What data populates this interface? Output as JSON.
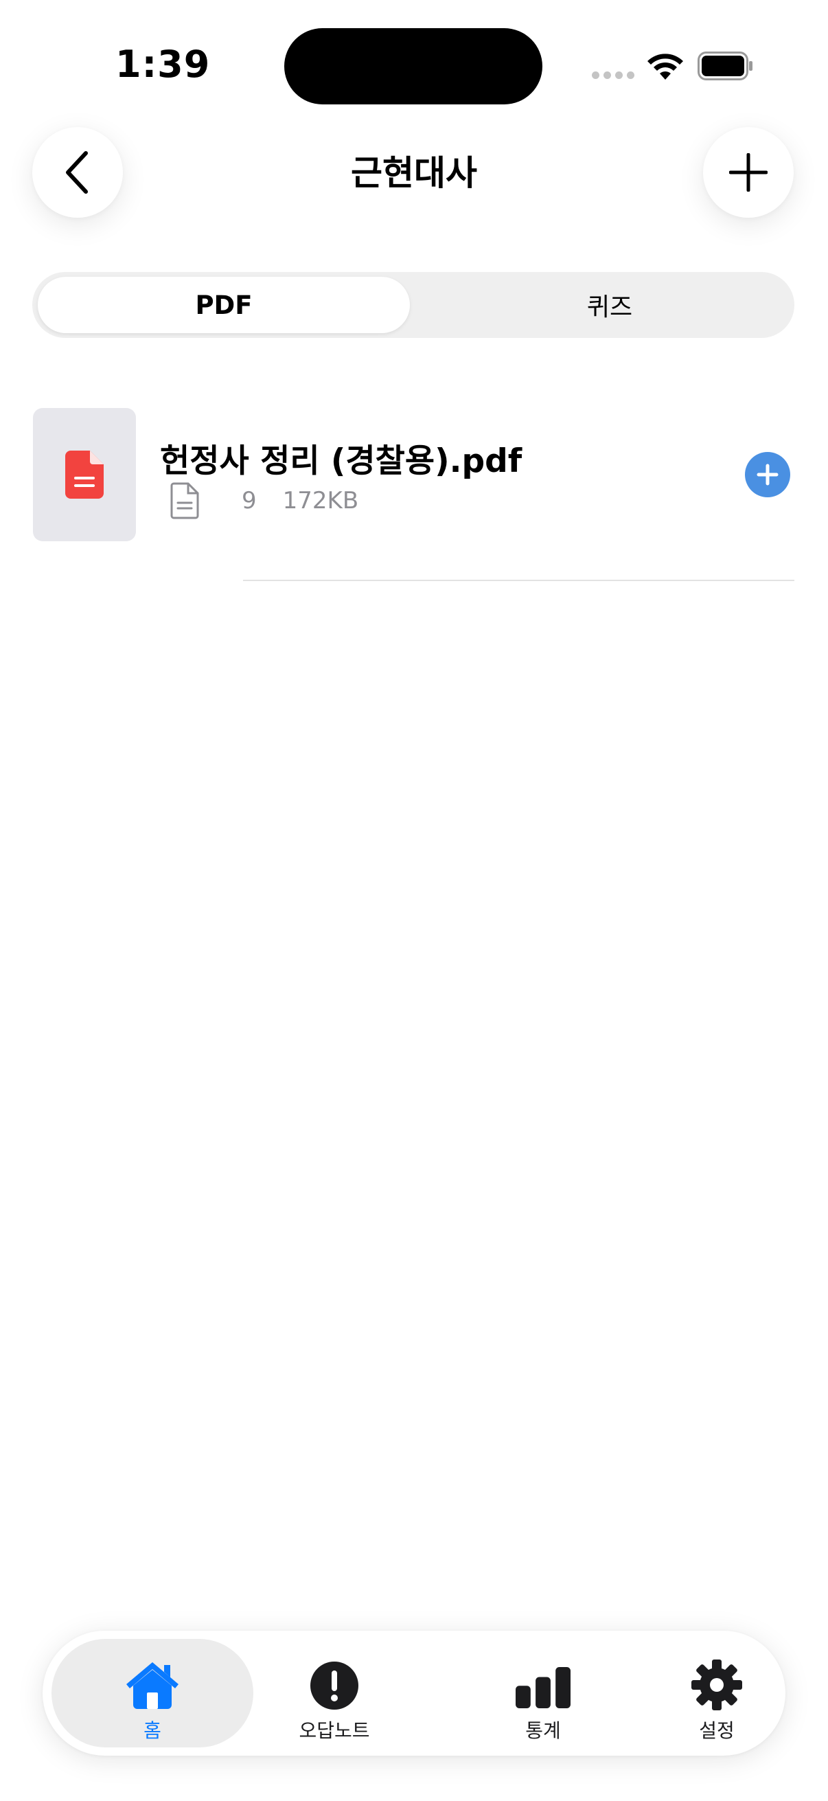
{
  "status_bar": {
    "time": "1:39"
  },
  "header": {
    "title": "근현대사"
  },
  "segmented": {
    "tabs": [
      "PDF",
      "퀴즈"
    ],
    "selected": "PDF"
  },
  "files": [
    {
      "name": "헌정사 정리 (경찰용).pdf",
      "pages": "9",
      "size": "172KB"
    }
  ],
  "tabbar": {
    "items": [
      {
        "label": "홈",
        "icon": "house-icon",
        "active": true
      },
      {
        "label": "오답노트",
        "icon": "exclamation-circle-icon",
        "active": false
      },
      {
        "label": "통계",
        "icon": "bar-chart-icon",
        "active": false
      },
      {
        "label": "설정",
        "icon": "gear-icon",
        "active": false
      }
    ]
  },
  "colors": {
    "accent": "#0a7aff",
    "pdf_red": "#f2433f",
    "add_blue": "#4a90e2"
  }
}
